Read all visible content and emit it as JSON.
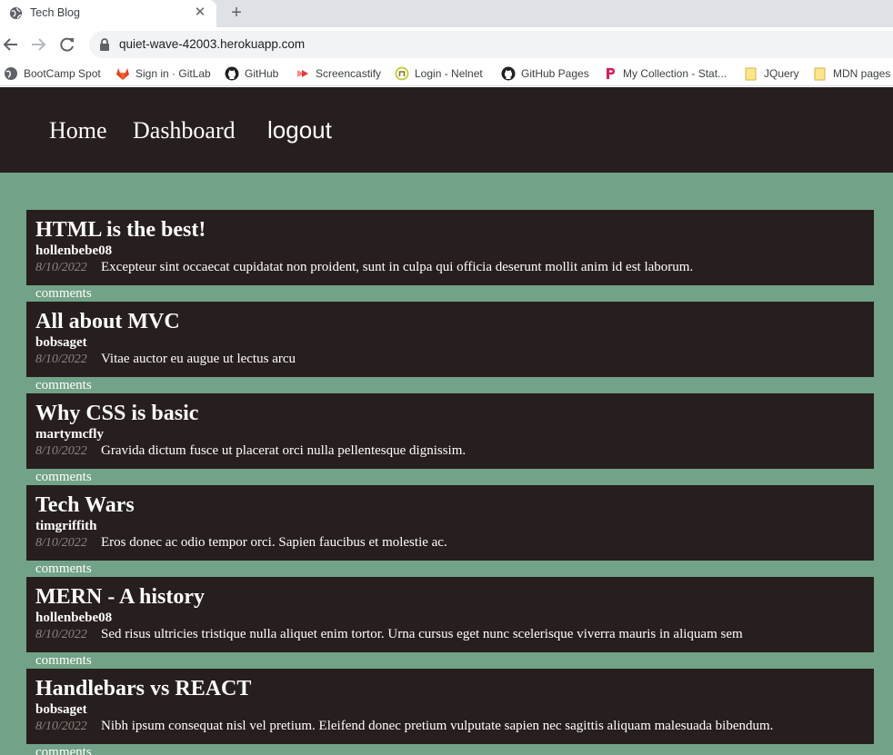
{
  "browser": {
    "tab_title": "Tech Blog",
    "url": "quiet-wave-42003.herokuapp.com",
    "bookmarks": [
      {
        "label": "BootCamp Spot",
        "icon": "globe-icon"
      },
      {
        "label": "Sign in · GitLab",
        "icon": "gitlab-icon"
      },
      {
        "label": "GitHub",
        "icon": "github-icon"
      },
      {
        "label": "Screencastify",
        "icon": "screencastify-icon"
      },
      {
        "label": "Login - Nelnet",
        "icon": "nelnet-icon"
      },
      {
        "label": "GitHub Pages",
        "icon": "github-icon"
      },
      {
        "label": "My Collection - Stat...",
        "icon": "postman-icon"
      },
      {
        "label": "JQuery",
        "icon": "folder-icon"
      },
      {
        "label": "MDN pages",
        "icon": "folder-icon"
      }
    ]
  },
  "nav": {
    "home": "Home",
    "dashboard": "Dashboard",
    "logout": "logout"
  },
  "colors": {
    "header_bg": "#261f1d",
    "page_bg": "#72a287",
    "card_bg": "#261f1d"
  },
  "posts": [
    {
      "title": "HTML is the best!",
      "author": "hollenbebe08",
      "date": "8/10/2022",
      "body": "Excepteur sint occaecat cupidatat non proident, sunt in culpa qui officia deserunt mollit anim id est laborum.",
      "comments_label": "comments"
    },
    {
      "title": "All about MVC",
      "author": "bobsaget",
      "date": "8/10/2022",
      "body": "Vitae auctor eu augue ut lectus arcu",
      "comments_label": "comments"
    },
    {
      "title": "Why CSS is basic",
      "author": "martymcfly",
      "date": "8/10/2022",
      "body": "Gravida dictum fusce ut placerat orci nulla pellentesque dignissim.",
      "comments_label": "comments"
    },
    {
      "title": "Tech Wars",
      "author": "timgriffith",
      "date": "8/10/2022",
      "body": "Eros donec ac odio tempor orci. Sapien faucibus et molestie ac.",
      "comments_label": "comments"
    },
    {
      "title": "MERN - A history",
      "author": "hollenbebe08",
      "date": "8/10/2022",
      "body": "Sed risus ultricies tristique nulla aliquet enim tortor. Urna cursus eget nunc scelerisque viverra mauris in aliquam sem",
      "comments_label": "comments"
    },
    {
      "title": "Handlebars vs REACT",
      "author": "bobsaget",
      "date": "8/10/2022",
      "body": "Nibh ipsum consequat nisl vel pretium. Eleifend donec pretium vulputate sapien nec sagittis aliquam malesuada bibendum.",
      "comments_label": "comments"
    }
  ]
}
